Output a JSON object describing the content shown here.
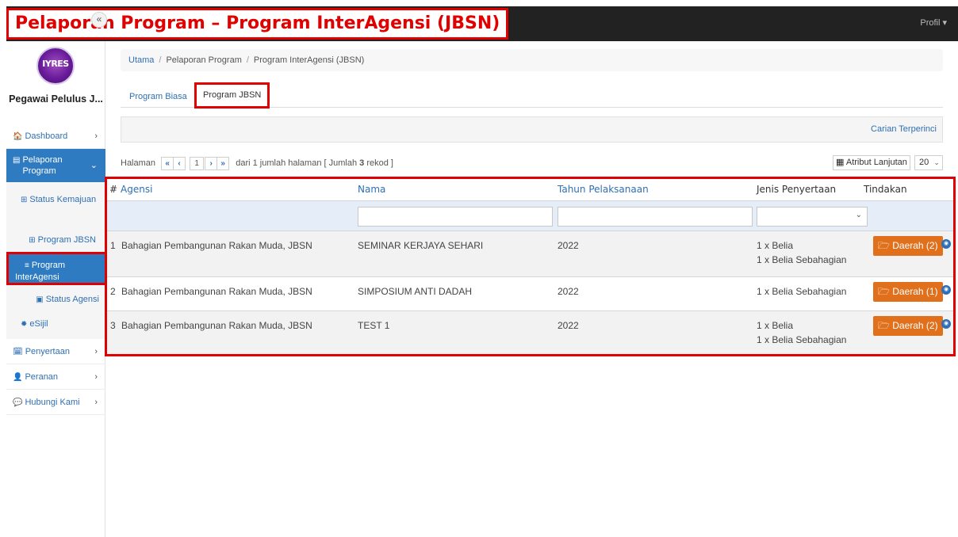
{
  "header": {
    "title": "Pelaporan Program – Program InterAgensi (JBSN)",
    "profile_label": "Profil ▾"
  },
  "sidebar": {
    "collapse_glyph": "«",
    "logo_text": "IYRES",
    "user_name": "Pegawai Pelulus J...",
    "items": [
      {
        "icon": "🏠",
        "label": "Dashboard",
        "chevron": "›"
      },
      {
        "icon": "▤",
        "label": "Pelaporan Program",
        "chevron": "⌄"
      },
      {
        "icon": "🗓",
        "label": "Penyertaan",
        "chevron": "›"
      },
      {
        "icon": "👤",
        "label": "Peranan",
        "chevron": "›"
      },
      {
        "icon": "💬",
        "label": "Hubungi Kami",
        "chevron": "›"
      }
    ],
    "submenu": [
      {
        "icon": "⊞",
        "label": "Status Kemajuan"
      },
      {
        "icon": "⊞",
        "label": "Program JBSN"
      },
      {
        "icon": "≡",
        "label": "Program InterAgensi"
      },
      {
        "icon": "▣",
        "label": "Status Agensi"
      },
      {
        "icon": "✹",
        "label": "eSijil"
      }
    ]
  },
  "breadcrumb": {
    "home": "Utama",
    "sep": "/",
    "level1": "Pelaporan Program",
    "level2": "Program InterAgensi (JBSN)"
  },
  "tabs": {
    "biasa": "Program Biasa",
    "jbsn": "Program JBSN"
  },
  "search": {
    "advanced_label": "Carian Terperinci"
  },
  "pagination": {
    "label": "Halaman",
    "first": "«",
    "prev": "‹",
    "current": "1",
    "next": "›",
    "last": "»",
    "info_prefix": "dari 1 jumlah halaman [ Jumlah",
    "record_count": "3",
    "info_suffix": "rekod ]",
    "attr_label": "Atribut Lanjutan",
    "page_size": "20"
  },
  "table": {
    "headers": {
      "index": "#",
      "agensi": "Agensi",
      "nama": "Nama",
      "tahun": "Tahun Pelaksanaan",
      "jenis": "Jenis Penyertaan",
      "tindakan": "Tindakan"
    },
    "rows": [
      {
        "index": "1",
        "agensi": "Bahagian Pembangunan Rakan Muda, JBSN",
        "nama": "SEMINAR KERJAYA SEHARI",
        "tahun": "2022",
        "jenis1": "1 x Belia",
        "jenis2": "1 x Belia Sebahagian",
        "button": "Daerah (2)"
      },
      {
        "index": "2",
        "agensi": "Bahagian Pembangunan Rakan Muda, JBSN",
        "nama": "SIMPOSIUM ANTI DADAH",
        "tahun": "2022",
        "jenis1": "1 x Belia Sebahagian",
        "jenis2": "",
        "button": "Daerah (1)"
      },
      {
        "index": "3",
        "agensi": "Bahagian Pembangunan Rakan Muda, JBSN",
        "nama": "TEST 1",
        "tahun": "2022",
        "jenis1": "1 x Belia",
        "jenis2": "1 x Belia Sebahagian",
        "button": "Daerah (2)"
      }
    ]
  },
  "icons": {
    "folder": "🗁",
    "eye": "◉",
    "grid": "▦",
    "caret": "⌄"
  }
}
